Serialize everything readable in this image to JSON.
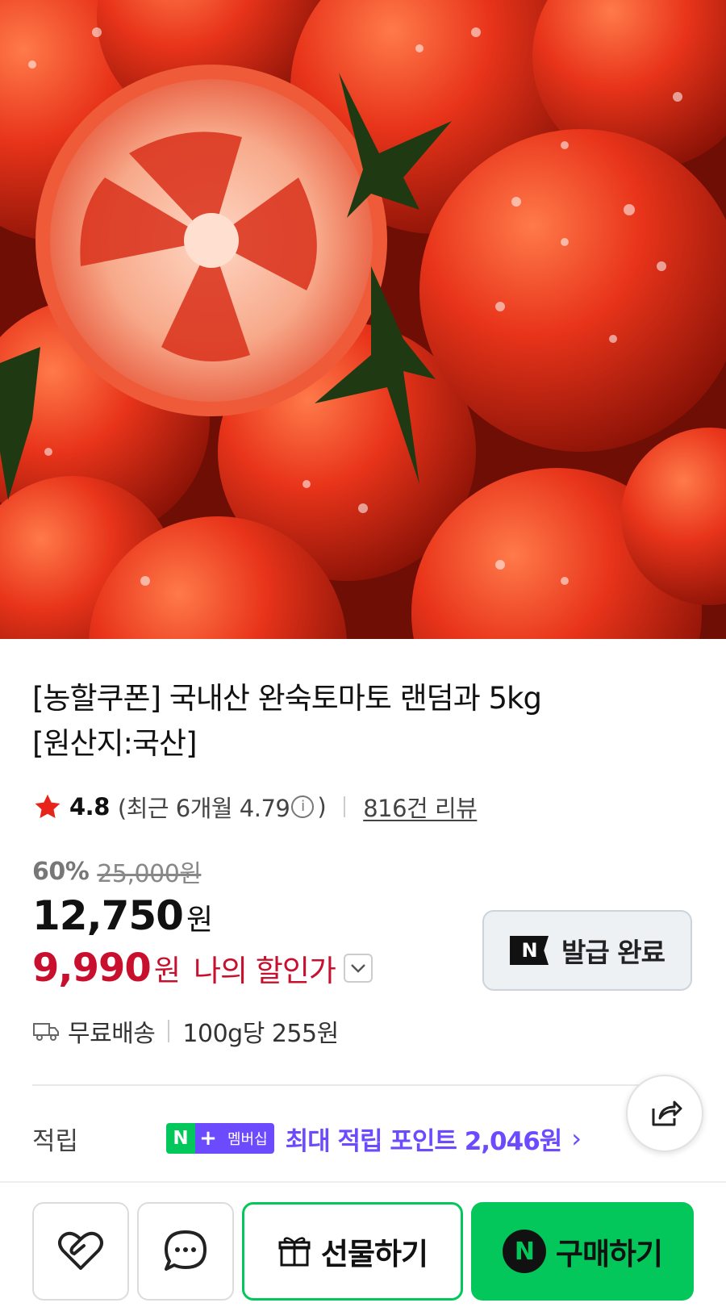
{
  "product": {
    "image_alt": "tomatoes",
    "title_line1": "[농할쿠폰] 국내산 완숙토마토 랜덤과 5kg",
    "title_line2": "[원산지:국산]"
  },
  "rating": {
    "score": "4.8",
    "recent_prefix": "(최근 6개월 4.79",
    "recent_suffix": ")",
    "info_icon": "i",
    "review_link": "816건 리뷰"
  },
  "price": {
    "discount_pct": "60%",
    "original": "25,000원",
    "sale": "12,750",
    "currency": "원",
    "my_price": "9,990",
    "my_currency": "원",
    "my_label": "나의 할인가"
  },
  "coupon": {
    "n_mark": "N",
    "label": "발급 완료"
  },
  "shipping": {
    "delivery": "무료배송",
    "unit_price": "100g당 255원"
  },
  "points": {
    "label": "적립",
    "badge_n": "N",
    "badge_plus": "+",
    "badge_text": "멤버십",
    "text": "최대 적립 포인트 2,046원",
    "chevron": "›"
  },
  "actions": {
    "gift_label": "선물하기",
    "buy_label": "구매하기",
    "buy_n": "N"
  },
  "colors": {
    "accent_red": "#c8102e",
    "naver_green": "#03c75a",
    "membership_purple": "#6c4bff"
  },
  "icons": {
    "star": "star-icon",
    "delivery": "truck-icon",
    "share": "share-icon",
    "wish": "heart-icon",
    "chat": "chat-bubble-icon",
    "gift": "gift-icon"
  }
}
